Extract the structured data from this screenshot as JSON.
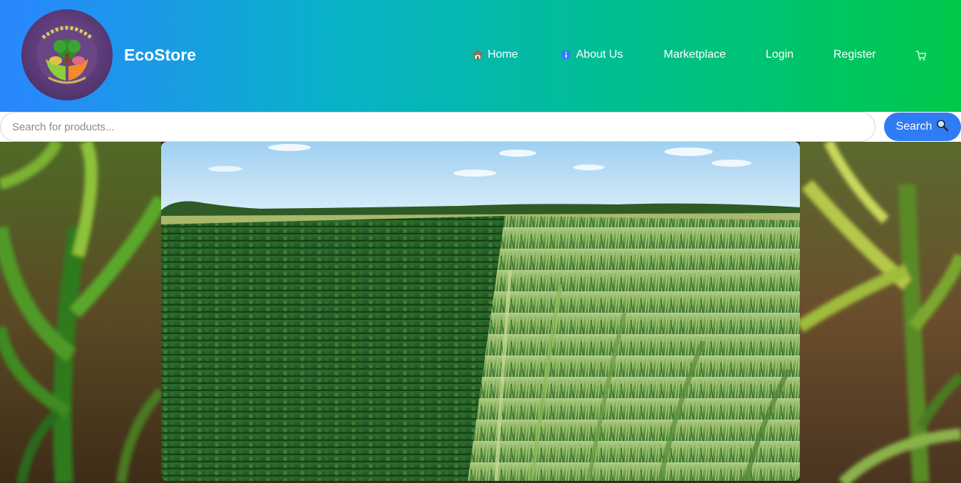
{
  "header": {
    "brand_name": "EcoStore",
    "logo": {
      "icon": "ecostore-logo-icon"
    },
    "nav": [
      {
        "label": "Home",
        "icon": "home-icon"
      },
      {
        "label": "About Us",
        "icon": "info-icon"
      },
      {
        "label": "Marketplace"
      },
      {
        "label": "Login"
      },
      {
        "label": "Register"
      }
    ],
    "cart": {
      "icon": "cart-icon"
    },
    "gradient_colors": [
      "#2a86ff",
      "#00c94a"
    ]
  },
  "search": {
    "placeholder": "Search for products...",
    "value": "",
    "button_label": "Search",
    "button_icon": "magnifier-icon",
    "button_color": "#2f7cf6"
  },
  "hero": {
    "image": "farm-field-image",
    "left_image": "corn-seedling-image",
    "right_image": "corn-seedling-image"
  }
}
